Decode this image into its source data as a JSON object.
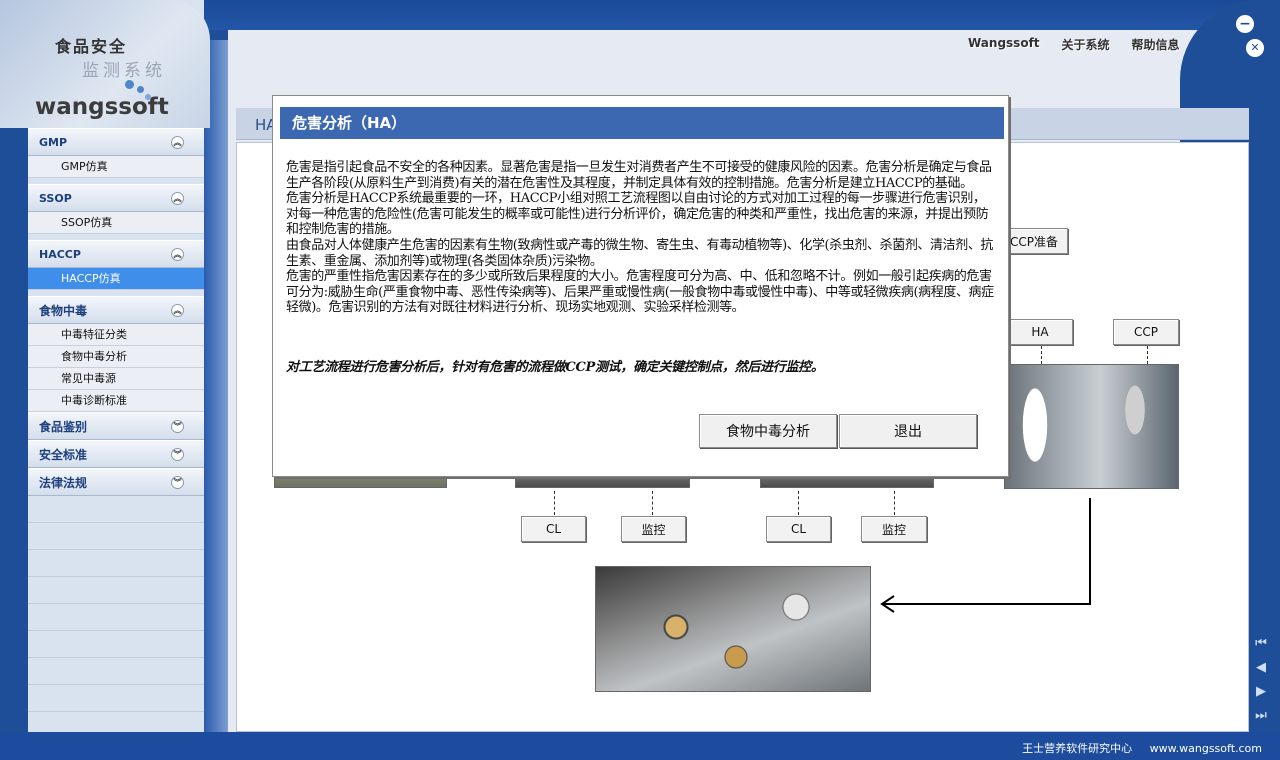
{
  "app": {
    "title_line1": "食品安全",
    "title_line2": "监测系统",
    "brand": "wangssoft"
  },
  "top_links": [
    "Wangssoft",
    "关于系统",
    "帮助信息"
  ],
  "window_buttons": {
    "minimize": "−",
    "close": "✕"
  },
  "sidebar": {
    "sections": [
      {
        "label": "GMP",
        "items": [
          "GMP仿真"
        ],
        "expanded": true
      },
      {
        "label": "SSOP",
        "items": [
          "SSOP仿真"
        ],
        "expanded": true
      },
      {
        "label": "HACCP",
        "items": [
          "HACCP仿真"
        ],
        "expanded": true,
        "active_item": "HACCP仿真"
      },
      {
        "label": "食物中毒",
        "items": [
          "中毒特征分类",
          "食物中毒分析",
          "常见中毒源",
          "中毒诊断标准"
        ],
        "expanded": true
      },
      {
        "label": "食品鉴别",
        "items": [],
        "expanded": false
      },
      {
        "label": "安全标准",
        "items": [],
        "expanded": false
      },
      {
        "label": "法律法规",
        "items": [],
        "expanded": false
      }
    ]
  },
  "content": {
    "title": "HA",
    "buttons": {
      "ccp_prep": "CCP准备",
      "ha": "HA",
      "ccp": "CCP",
      "cl1": "CL",
      "monitor1": "监控",
      "cl2": "CL",
      "monitor2": "监控"
    }
  },
  "modal": {
    "title": "危害分析（HA）",
    "paragraphs": [
      "危害是指引起食品不安全的各种因素。显著危害是指一旦发生对消费者产生不可接受的健康风险的因素。危害分析是确定与食品生产各阶段(从原料生产到消费)有关的潜在危害性及其程度，并制定具体有效的控制措施。危害分析是建立HACCP的基础。",
      "危害分析是HACCP系统最重要的一环，HACCP小组对照工艺流程图以自由讨论的方式对加工过程的每一步骤进行危害识别，对每一种危害的危险性(危害可能发生的概率或可能性)进行分析评价，确定危害的种类和严重性，找出危害的来源，并提出预防和控制危害的措施。",
      "由食品对人体健康产生危害的因素有生物(致病性或产毒的微生物、寄生虫、有毒动植物等)、化学(杀虫剂、杀菌剂、清洁剂、抗生素、重金属、添加剂等)或物理(各类固体杂质)污染物。",
      "危害的严重性指危害因素存在的多少或所致后果程度的大小。危害程度可分为高、中、低和忽略不计。例如一般引起疾病的危害可分为:威胁生命(严重食物中毒、恶性传染病等)、后果严重或慢性病(一般食物中毒或慢性中毒)、中等或轻微疾病(病程度、病症轻微)。危害识别的方法有对既往材料进行分析、现场实地观测、实验采样检测等。"
    ],
    "emphasis": "对工艺流程进行危害分析后，针对有危害的流程做CCP测试，确定关键控制点，然后进行监控。",
    "button_food_poisoning": "食物中毒分析",
    "button_exit": "退出"
  },
  "footer": {
    "org": "王士营养软件研究中心",
    "url": "www.wangssoft.com"
  },
  "nav": [
    "first-icon",
    "prev-icon",
    "next-icon",
    "last-icon"
  ]
}
